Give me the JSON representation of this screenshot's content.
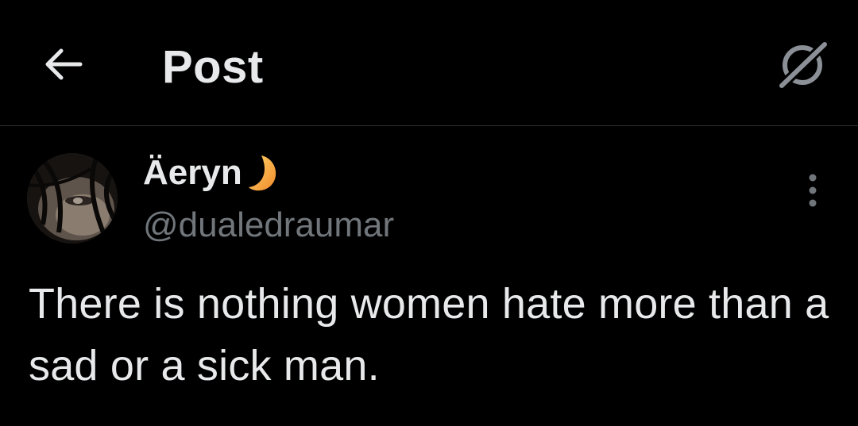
{
  "header": {
    "back_icon": "arrow-left-icon",
    "title": "Post",
    "grok_icon": "grok-icon"
  },
  "post": {
    "author": {
      "display_name": "Äeryn",
      "name_emoji": "crescent-moon-icon",
      "handle": "@dualedraumar"
    },
    "more_icon": "more-vertical-icon",
    "text": "There is nothing women hate more than a sad or a sick man."
  },
  "colors": {
    "background": "#000000",
    "primary_text": "#e7e9ea",
    "secondary_text": "#71767b",
    "divider": "#2f3336",
    "moon": "#f4a23a"
  }
}
